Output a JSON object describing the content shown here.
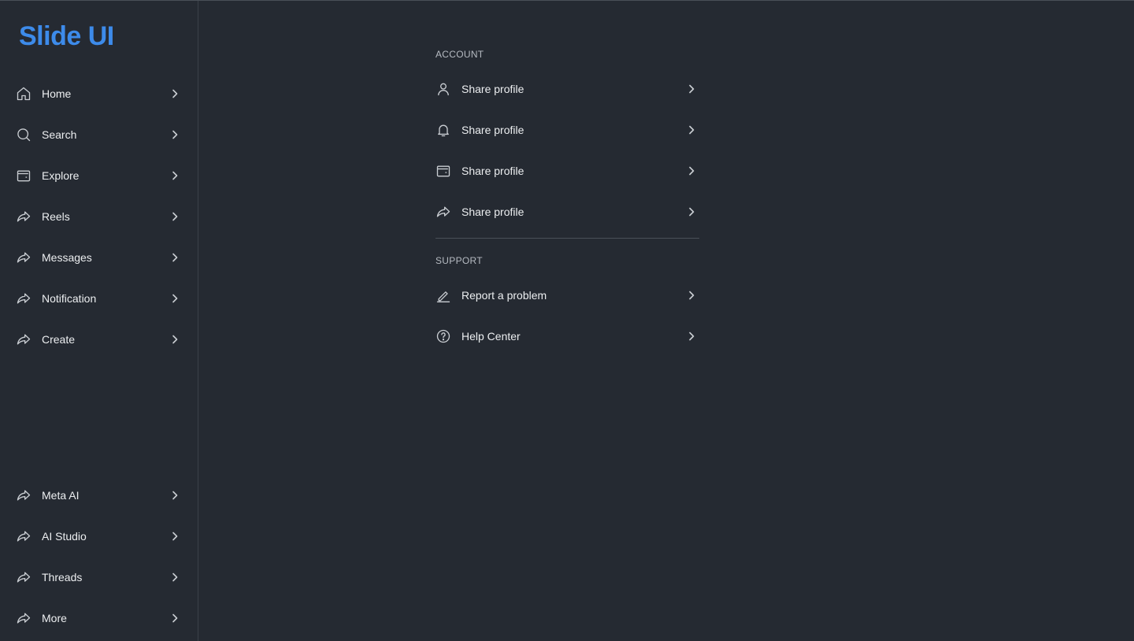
{
  "brand": {
    "name": "Slide UI",
    "color": "#3d8bea"
  },
  "sidebar": {
    "items": [
      {
        "label": "Home",
        "icon": "home-icon"
      },
      {
        "label": "Search",
        "icon": "search-icon"
      },
      {
        "label": "Explore",
        "icon": "wallet-icon"
      },
      {
        "label": "Reels",
        "icon": "share-arrow-icon"
      },
      {
        "label": "Messages",
        "icon": "share-arrow-icon"
      },
      {
        "label": "Notification",
        "icon": "share-arrow-icon"
      },
      {
        "label": "Create",
        "icon": "share-arrow-icon"
      }
    ],
    "bottom_items": [
      {
        "label": "Meta AI",
        "icon": "share-arrow-icon"
      },
      {
        "label": "AI Studio",
        "icon": "share-arrow-icon"
      },
      {
        "label": "Threads",
        "icon": "share-arrow-icon"
      },
      {
        "label": "More",
        "icon": "share-arrow-icon"
      }
    ]
  },
  "settings": {
    "account": {
      "title": "ACCOUNT",
      "items": [
        {
          "label": "Share profile",
          "icon": "user-icon"
        },
        {
          "label": "Share profile",
          "icon": "bell-icon"
        },
        {
          "label": "Share profile",
          "icon": "wallet-icon"
        },
        {
          "label": "Share profile",
          "icon": "share-arrow-icon"
        }
      ]
    },
    "support": {
      "title": "SUPPORT",
      "items": [
        {
          "label": "Report a problem",
          "icon": "pencil-icon"
        },
        {
          "label": "Help Center",
          "icon": "help-circle-icon"
        }
      ]
    }
  }
}
